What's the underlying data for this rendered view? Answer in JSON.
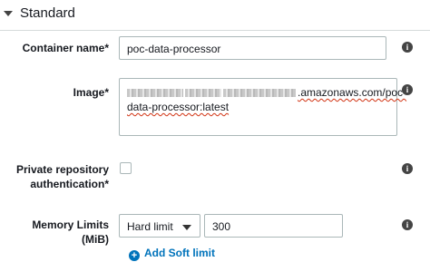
{
  "section": {
    "title": "Standard"
  },
  "container_name": {
    "label": "Container name*",
    "value": "poc-data-processor"
  },
  "image": {
    "label": "Image*",
    "value_suffix_line1": ".amazonaws.com/poc-",
    "value_line2": "data-processor:latest"
  },
  "private_repo": {
    "label_line1": "Private repository",
    "label_line2": "authentication*",
    "checked": false
  },
  "memory_limits": {
    "label_line1": "Memory Limits",
    "label_line2": "(MiB)",
    "limit_type": "Hard limit",
    "value": "300",
    "add_link_label": "Add Soft limit"
  },
  "icons": {
    "info": "info-icon",
    "caret": "caret-down-icon",
    "add": "plus-circle-icon"
  }
}
